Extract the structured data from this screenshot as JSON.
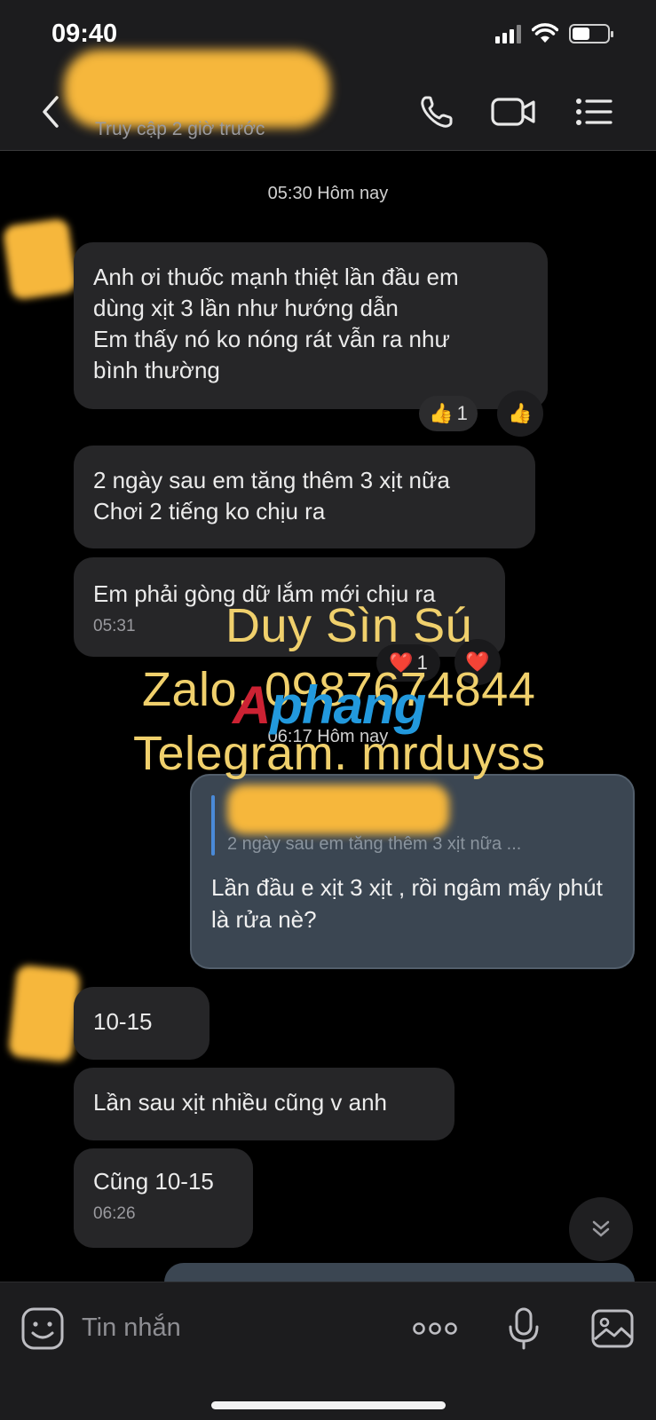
{
  "status_bar": {
    "time": "09:40"
  },
  "header": {
    "presence": "Truy cập 2 giờ trước"
  },
  "date_separators": [
    "05:30 Hôm nay",
    "06:17 Hôm nay"
  ],
  "messages": [
    {
      "lines": [
        "Anh ơi thuốc mạnh thiệt lần đầu em",
        "dùng xịt 3 lần như hướng dẫn",
        "Em thấy nó ko nóng rát vẫn ra như",
        "bình thường"
      ]
    },
    {
      "lines": [
        "2 ngày sau em tăng thêm 3 xịt nữa",
        "Chơi 2 tiếng ko chịu ra"
      ]
    },
    {
      "text": "Em phải gòng dữ lắm mới chịu ra",
      "time": "05:31"
    },
    {
      "text": "10-15"
    },
    {
      "text": "Lần sau xịt nhiều cũng v anh"
    },
    {
      "text": "Cũng 10-15",
      "time": "06:26"
    }
  ],
  "reactions": {
    "like_count": "1",
    "heart_count": "1"
  },
  "reply": {
    "quoted_snippet": "2 ngày sau em tăng thêm 3 xịt nữa ...",
    "text": "Lần đầu e xịt 3 xịt , rồi ngâm mấy phút là rửa nè?"
  },
  "watermark": {
    "line1": "Duy Sìn Sú",
    "line2": "Zalo. 0987674844",
    "line3": "Telegram. mrduyss",
    "brand_part1": "A",
    "brand_part2": "phang"
  },
  "input": {
    "placeholder": "Tin nhắn"
  },
  "colors": {
    "accent_yellow": "#f0d06c",
    "bubble_dark": "#262628",
    "bubble_sent": "#3b4652",
    "quote_bar": "#4a8ad8"
  }
}
